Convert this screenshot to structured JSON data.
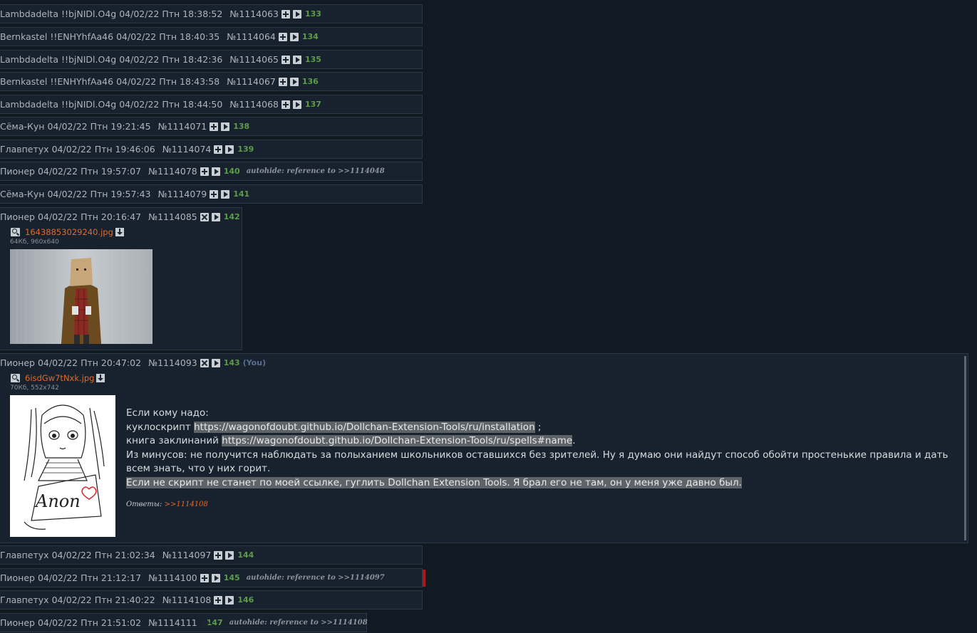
{
  "hidden_posts_top": [
    {
      "name": "Lambdadelta !!bjNIDl.O4g",
      "date": "04/02/22 Птн 18:38:52",
      "num": "№1114063",
      "count": "133"
    },
    {
      "name": "Bernkastel !!ENHYhfAa46",
      "date": "04/02/22 Птн 18:40:35",
      "num": "№1114064",
      "count": "134"
    },
    {
      "name": "Lambdadelta !!bjNIDl.O4g",
      "date": "04/02/22 Птн 18:42:36",
      "num": "№1114065",
      "count": "135"
    },
    {
      "name": "Bernkastel !!ENHYhfAa46",
      "date": "04/02/22 Птн 18:43:58",
      "num": "№1114067",
      "count": "136"
    },
    {
      "name": "Lambdadelta !!bjNIDl.O4g",
      "date": "04/02/22 Птн 18:44:50",
      "num": "№1114068",
      "count": "137"
    },
    {
      "name": "Сёма-Кун",
      "date": "04/02/22 Птн 19:21:45",
      "num": "№1114071",
      "count": "138"
    },
    {
      "name": "Главпетух",
      "date": "04/02/22 Птн 19:46:06",
      "num": "№1114074",
      "count": "139"
    },
    {
      "name": "Пионер",
      "date": "04/02/22 Птн 19:57:07",
      "num": "№1114078",
      "count": "140",
      "autohide": "autohide: reference to >>1114048"
    },
    {
      "name": "Сёма-Кун",
      "date": "04/02/22 Птн 19:57:43",
      "num": "№1114079",
      "count": "141"
    }
  ],
  "post_142": {
    "name": "Пионер",
    "date": "04/02/22 Птн 20:16:47",
    "num": "№1114085",
    "count": "142",
    "file_name": "16438853029240.jpg",
    "file_meta": "64Кб, 960x640"
  },
  "post_143": {
    "name": "Пионер",
    "date": "04/02/22 Птн 20:47:02",
    "num": "№1114093",
    "count": "143",
    "you": "(You)",
    "file_name": "6isdGw7tNxk.jpg",
    "file_meta": "70Кб, 552x742",
    "thumb_text": "Anon",
    "line1": "Если кому надо:",
    "line2_prefix": "куклоскрипт ",
    "line2_link": "https://wagonofdoubt.github.io/Dollchan-Extension-Tools/ru/installation",
    "line2_suffix": " ;",
    "line3_prefix": "книга заклинаний ",
    "line3_link": "https://wagonofdoubt.github.io/Dollchan-Extension-Tools/ru/spells#name",
    "line3_suffix": ".",
    "line4": "Из минусов: не получится наблюдать за полыханием школьников оставшихся без зрителей. Ну я думаю они найдут способ обойти простенькие правила и дать всем знать, что у них горит.",
    "line5": "Если не скрипт не станет по моей ссылке, гуглить Dollchan Extension Tools. Я брал его не там, он у меня уже давно был.",
    "replies_label": "Ответы: ",
    "replies_link": ">>1114108"
  },
  "hidden_posts_bottom": [
    {
      "name": "Главпетух",
      "date": "04/02/22 Птн 21:02:34",
      "num": "№1114097",
      "count": "144"
    },
    {
      "name": "Пионер",
      "date": "04/02/22 Птн 21:12:17",
      "num": "№1114100",
      "count": "145",
      "autohide": "autohide: reference to >>1114097"
    },
    {
      "name": "Главпетух",
      "date": "04/02/22 Птн 21:40:22",
      "num": "№1114108",
      "count": "146"
    },
    {
      "name": "Пионер",
      "date": "04/02/22 Птн 21:51:02",
      "num": "№1114111",
      "count": "147",
      "autohide": "autohide: reference to >>1114108"
    }
  ]
}
